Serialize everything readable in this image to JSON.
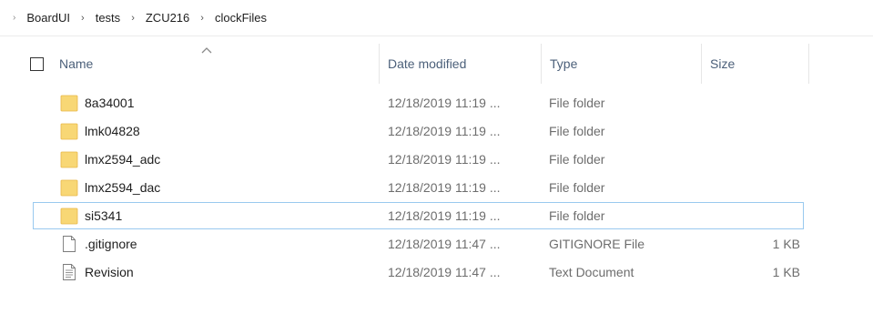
{
  "breadcrumb": {
    "items": [
      "BoardUI",
      "tests",
      "ZCU216",
      "clockFiles"
    ]
  },
  "columns": {
    "name": "Name",
    "date": "Date modified",
    "type": "Type",
    "size": "Size"
  },
  "files": [
    {
      "name": "8a34001",
      "date": "12/18/2019 11:19 ...",
      "type": "File folder",
      "size": "",
      "icon": "folder-icon"
    },
    {
      "name": "lmk04828",
      "date": "12/18/2019 11:19 ...",
      "type": "File folder",
      "size": "",
      "icon": "folder-icon"
    },
    {
      "name": "lmx2594_adc",
      "date": "12/18/2019 11:19 ...",
      "type": "File folder",
      "size": "",
      "icon": "folder-icon"
    },
    {
      "name": "lmx2594_dac",
      "date": "12/18/2019 11:19 ...",
      "type": "File folder",
      "size": "",
      "icon": "folder-icon"
    },
    {
      "name": "si5341",
      "date": "12/18/2019 11:19 ...",
      "type": "File folder",
      "size": "",
      "icon": "folder-icon",
      "focused": true
    },
    {
      "name": ".gitignore",
      "date": "12/18/2019 11:47 ...",
      "type": "GITIGNORE File",
      "size": "1 KB",
      "icon": "file-icon"
    },
    {
      "name": "Revision",
      "date": "12/18/2019 11:47 ...",
      "type": "Text Document",
      "size": "1 KB",
      "icon": "text-document-icon"
    }
  ],
  "colors": {
    "folder": "#f8d775",
    "folder_dark": "#e8b84a",
    "header_text": "#4c607a",
    "focus_border": "#99c9ef"
  }
}
